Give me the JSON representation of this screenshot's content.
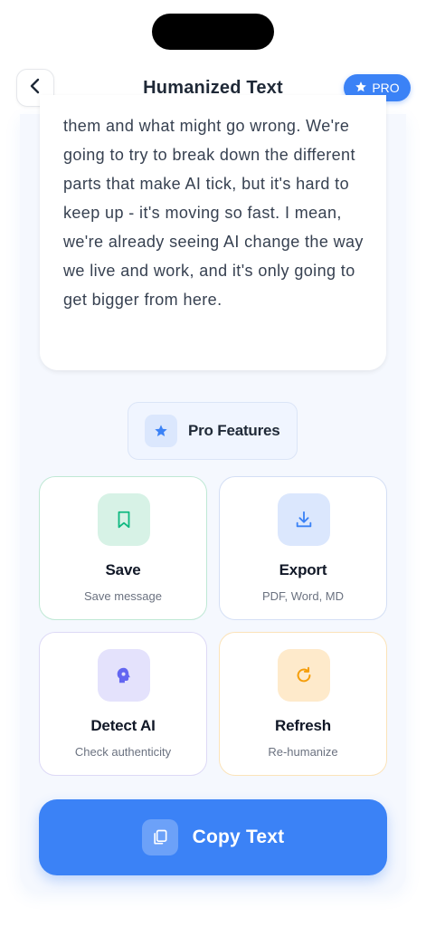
{
  "header": {
    "title": "Humanized Text",
    "pro_badge": "PRO"
  },
  "content": {
    "humanized_text": "them and what might go wrong. We're going to try to break down the different parts that make AI tick, but it's hard to keep up - it's moving so fast. I mean, we're already seeing AI change the way we live and work, and it's only going to get bigger from here."
  },
  "pro_features": {
    "label": "Pro Features",
    "items": [
      {
        "title": "Save",
        "subtitle": "Save message",
        "icon": "bookmark-icon",
        "color": "#10b981"
      },
      {
        "title": "Export",
        "subtitle": "PDF, Word, MD",
        "icon": "download-icon",
        "color": "#3b82f6"
      },
      {
        "title": "Detect AI",
        "subtitle": "Check authenticity",
        "icon": "brain-icon",
        "color": "#6366f1"
      },
      {
        "title": "Refresh",
        "subtitle": "Re-humanize",
        "icon": "refresh-icon",
        "color": "#f59e0b"
      }
    ]
  },
  "copy_button": {
    "label": "Copy Text",
    "icon": "copy-icon"
  },
  "colors": {
    "accent": "#3b82f6",
    "panel_bg": "#f5f8fe"
  }
}
